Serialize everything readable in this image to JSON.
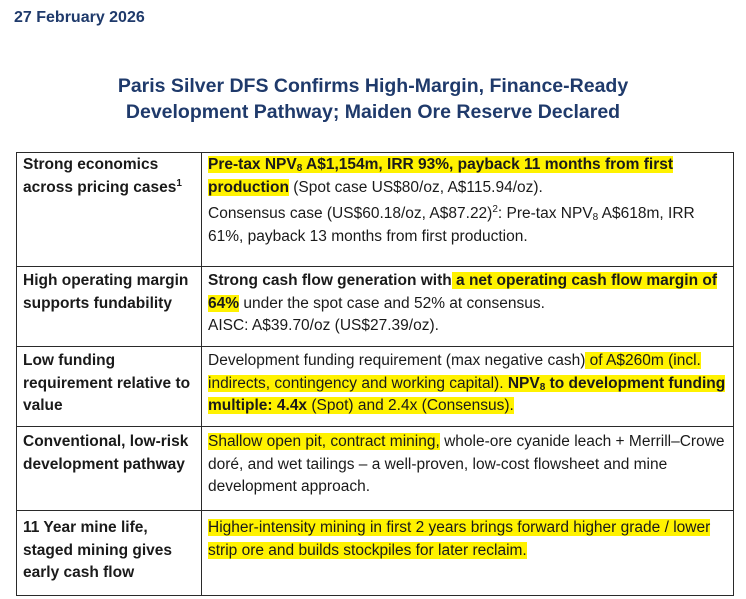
{
  "header": {
    "date": "27 February 2026",
    "title_line1": "Paris Silver DFS Confirms High-Margin, Finance-Ready",
    "title_line2": "Development Pathway; Maiden Ore Reserve Declared"
  },
  "highlight_color": "#fff200",
  "rows": [
    {
      "label": "Strong economics across pricing cases",
      "label_sup": "1",
      "p1_bold_a": "Pre-tax NPV",
      "p1_sub": "8",
      "p1_bold_b": " A$1,154m, IRR 93%, payback 11 months from first production",
      "p1_rest": " (Spot case US$80/oz, A$115.94/oz).",
      "p2_a": "Consensus case (US$60.18/oz, A$87.22)",
      "p2_sup": "2",
      "p2_b": ": Pre-tax NPV",
      "p2_sub": "8",
      "p2_c": " A$618m, IRR 61%, payback 13 months from first production."
    },
    {
      "label": "High operating margin supports fundability",
      "bold_a": "Strong cash flow generation with",
      "bold_b": " a net operating cash flow margin of 64%",
      "rest": " under the spot case and 52% at consensus.",
      "aisc": "AISC: A$39.70/oz (US$27.39/oz)."
    },
    {
      "label": "Low funding requirement relative to value",
      "text_a": "Development funding requirement (max negative cash)",
      "text_b": " of A$260m (incl. indirects, contingency and working capital).",
      "bold_a": " NPV",
      "sub": "8",
      "bold_b": " to development funding multiple: 4.4x",
      "rest": " (Spot) and 2.4x (Consensus)."
    },
    {
      "label": "Conventional, low-risk development pathway",
      "hl_text": "Shallow open pit, contract mining,",
      "rest": " whole-ore cyanide leach + Merrill–Crowe doré, and wet tailings – a well-proven, low-cost flowsheet and mine development approach."
    },
    {
      "label": "11 Year mine life, staged mining gives early cash flow",
      "hl_text": "Higher-intensity mining in first 2 years brings forward higher grade / lower strip ore and builds stockpiles for later reclaim."
    }
  ]
}
